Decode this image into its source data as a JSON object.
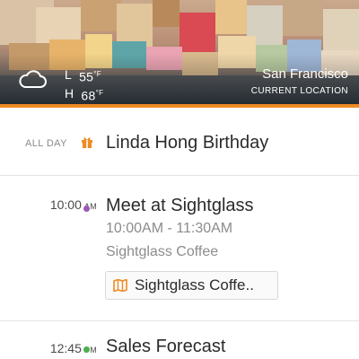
{
  "header": {
    "weather_icon": "cloud-icon",
    "low_label": "L",
    "low_temp": "55",
    "high_label": "H",
    "high_temp": "68",
    "degree_unit": "°F",
    "city": "San Francisco",
    "location_sub": "CURRENT LOCATION",
    "accent_color": "#f08a24"
  },
  "all_day": {
    "label": "ALL DAY",
    "icon": "gift-icon",
    "icon_color": "#f08a24",
    "title": "Linda Hong Birthday"
  },
  "events": [
    {
      "time": "10:00",
      "ampm": "AM",
      "dot_color": "#9b59b6",
      "title": "Meet at Sightglass",
      "time_range": "10:00AM - 11:30AM",
      "location": "Sightglass Coffee",
      "map_button_icon": "map-icon",
      "map_button_label": "Sightglass Coffe.."
    },
    {
      "time": "12:45",
      "ampm": "PM",
      "dot_color": "#4caf50",
      "title": "Sales Forecast"
    }
  ]
}
